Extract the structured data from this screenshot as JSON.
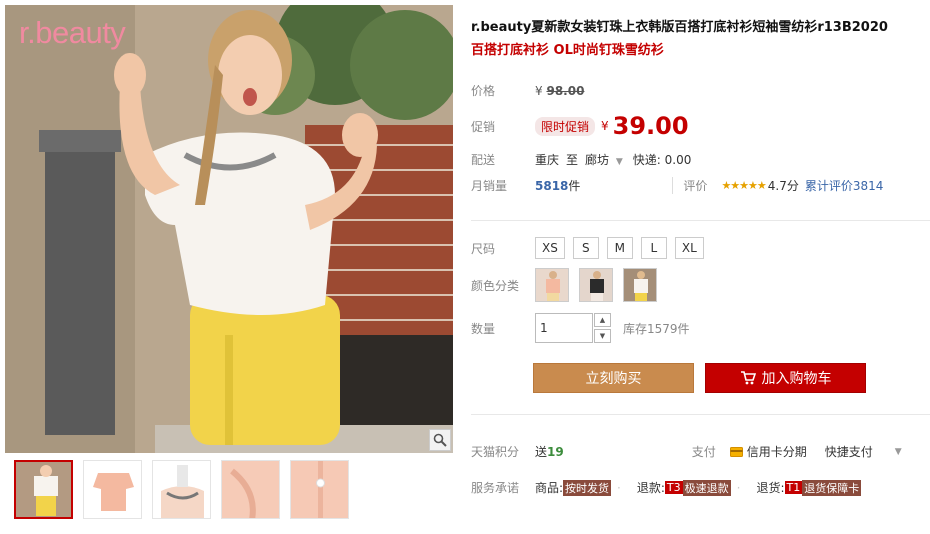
{
  "brand": {
    "logo_text": "r.beauty"
  },
  "product": {
    "title": "r.beauty夏新款女装钉珠上衣韩版百搭打底衬衫短袖雪纺衫r13B2020",
    "subtitle": "百搭打底衬衫 OL时尚钉珠雪纺衫"
  },
  "price": {
    "label": "价格",
    "currency": "¥",
    "original": "98.00"
  },
  "promo": {
    "label": "促销",
    "tag": "限时促销",
    "currency": "¥",
    "price": "39.00"
  },
  "shipping": {
    "label": "配送",
    "from": "重庆",
    "to_word": "至",
    "to": "廊坊",
    "method": "快递: 0.00"
  },
  "sales": {
    "label": "月销量",
    "count": "5818",
    "unit": "件",
    "review_label": "评价",
    "stars": "★★★★★",
    "rating": "4.7分",
    "review_total": "累计评价3814"
  },
  "size": {
    "label": "尺码",
    "options": [
      "XS",
      "S",
      "M",
      "L",
      "XL"
    ]
  },
  "color": {
    "label": "颜色分类"
  },
  "quantity": {
    "label": "数量",
    "value": "1",
    "stock": "库存1579件"
  },
  "buttons": {
    "buy_now": "立刻购买",
    "add_cart": "加入购物车"
  },
  "points": {
    "label": "天猫积分",
    "send": "送",
    "amount": "19"
  },
  "payment": {
    "label": "支付",
    "credit": "信用卡分期",
    "quick": "快捷支付"
  },
  "service": {
    "label": "服务承诺",
    "goods_label": "商品:",
    "goods_tag": "按时发货",
    "refund_label": "退款:",
    "refund_code": "T3",
    "refund_tag": "极速退款",
    "return_label": "退货:",
    "return_code": "T1",
    "return_tag": "退货保障卡"
  },
  "colors": {
    "accent": "#c40000",
    "buy_button": "#c98b4e",
    "link_blue": "#3a66a8"
  }
}
